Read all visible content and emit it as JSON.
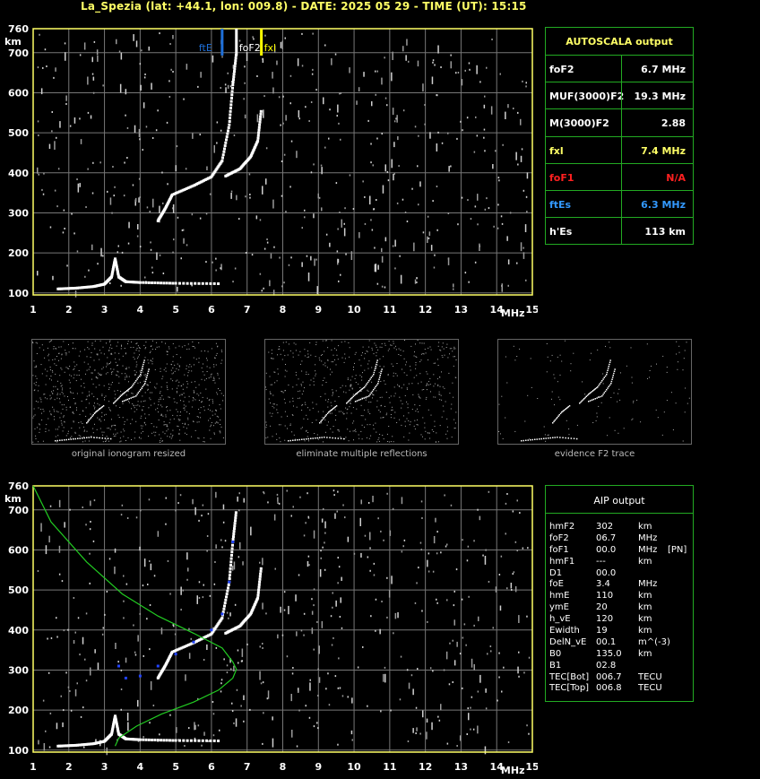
{
  "header": "La_Spezia (lat: +44.1, lon: 009.8) - DATE: 2025 05 29 - TIME (UT): 15:15",
  "colors": {
    "grid": "#777777",
    "axis": "#ffff66",
    "panel_border": "#22aa22",
    "trace": "#ffffff",
    "fxl": "#ffff00",
    "ftE": "#1e6fd9",
    "foF1": "#ff2020",
    "profile": "#22cc22",
    "aip_points": "#2244ff"
  },
  "axis": {
    "y_unit": "km",
    "x_unit": "MHz",
    "y_ticks": [
      "760",
      "700",
      "600",
      "500",
      "400",
      "300",
      "200",
      "100"
    ],
    "x_ticks": [
      "1",
      "2",
      "3",
      "4",
      "5",
      "6",
      "7",
      "8",
      "9",
      "10",
      "11",
      "12",
      "13",
      "14",
      "15"
    ]
  },
  "markers": {
    "ftE": "ftE",
    "foF2": "foF2",
    "fxl": "fxl"
  },
  "autoscala": {
    "title": "AUTOSCALA output",
    "rows": [
      {
        "key": "foF2",
        "value": "6.7 MHz",
        "color": "#ffffff"
      },
      {
        "key": "MUF(3000)F2",
        "value": "19.3 MHz",
        "color": "#ffffff"
      },
      {
        "key": "M(3000)F2",
        "value": "2.88",
        "color": "#ffffff"
      },
      {
        "key": "fxl",
        "value": "7.4 MHz",
        "color": "#ffff66"
      },
      {
        "key": "foF1",
        "value": "N/A",
        "color": "#ff2020"
      },
      {
        "key": "ftEs",
        "value": "6.3 MHz",
        "color": "#3399ff"
      },
      {
        "key": "h'Es",
        "value": "113     km",
        "color": "#ffffff"
      }
    ]
  },
  "captions": {
    "thumb1": "original ionogram resized",
    "thumb2": "eliminate multiple reflections",
    "thumb3": "evidence F2 trace"
  },
  "aip": {
    "title": "AIP output",
    "rows": [
      [
        "hmF2",
        "302",
        "km",
        ""
      ],
      [
        "foF2",
        "06.7",
        "MHz",
        ""
      ],
      [
        "foF1",
        "00.0",
        "MHz",
        "[PN]"
      ],
      [
        "hmF1",
        "---",
        "km",
        ""
      ],
      [
        "D1",
        "00.0",
        "",
        ""
      ],
      [
        "foE",
        "3.4",
        "MHz",
        ""
      ],
      [
        "hmE",
        "110",
        "km",
        ""
      ],
      [
        "ymE",
        "20",
        "km",
        ""
      ],
      [
        "h_vE",
        "120",
        "km",
        ""
      ],
      [
        "Ewidth",
        "19",
        "km",
        ""
      ],
      [
        "DelN_vE",
        "00.1",
        "m^(-3)",
        ""
      ],
      [
        "B0",
        "135.0",
        "km",
        ""
      ],
      [
        "B1",
        "02.8",
        "",
        ""
      ],
      [
        "TEC[Bot]",
        "006.7",
        "TECU",
        ""
      ],
      [
        "TEC[Top]",
        "006.8",
        "TECU",
        ""
      ]
    ]
  },
  "chart_data": [
    {
      "type": "scatter",
      "title": "",
      "xlabel": "MHz",
      "ylabel": "km",
      "xlim": [
        1,
        15
      ],
      "ylim": [
        95,
        760
      ],
      "grid": true,
      "series": [
        {
          "name": "",
          "values": [
            [
              1.7,
              110
            ],
            [
              2.2,
              112
            ],
            [
              2.7,
              116
            ],
            [
              3.0,
              122
            ],
            [
              3.2,
              140
            ],
            [
              3.3,
              185
            ],
            [
              3.4,
              140
            ],
            [
              3.6,
              128
            ],
            [
              4.0,
              126
            ],
            [
              5.0,
              124
            ],
            [
              6.3,
              123
            ]
          ]
        },
        {
          "name": "",
          "values": [
            [
              4.5,
              280
            ],
            [
              4.7,
              310
            ],
            [
              4.9,
              345
            ],
            [
              5.5,
              368
            ],
            [
              6.0,
              390
            ],
            [
              6.3,
              430
            ],
            [
              6.5,
              520
            ],
            [
              6.6,
              620
            ],
            [
              6.7,
              700
            ]
          ]
        },
        {
          "name": "",
          "values": [
            [
              6.4,
              392
            ],
            [
              6.8,
              410
            ],
            [
              7.1,
              440
            ],
            [
              7.3,
              480
            ],
            [
              7.4,
              560
            ]
          ]
        }
      ],
      "annotations": [
        {
          "label": "ftE",
          "x": 6.3
        },
        {
          "label": "foF2",
          "x": 6.7
        },
        {
          "label": "fxl",
          "x": 7.4
        }
      ]
    },
    {
      "type": "line",
      "title": "",
      "xlabel": "MHz",
      "ylabel": "km",
      "xlim": [
        1,
        15
      ],
      "ylim": [
        95,
        760
      ],
      "grid": true,
      "series": [
        {
          "name": "",
          "values": [
            [
              1.0,
              760
            ],
            [
              1.5,
              670
            ],
            [
              2.5,
              570
            ],
            [
              3.5,
              490
            ],
            [
              4.5,
              435
            ],
            [
              5.5,
              392
            ],
            [
              6.3,
              355
            ],
            [
              6.6,
              320
            ],
            [
              6.7,
              302
            ],
            [
              6.6,
              280
            ],
            [
              6.2,
              250
            ],
            [
              5.5,
              220
            ],
            [
              4.6,
              190
            ],
            [
              3.9,
              160
            ],
            [
              3.4,
              130
            ],
            [
              3.3,
              110
            ]
          ]
        },
        {
          "name": "",
          "values": [
            [
              3.4,
              310
            ],
            [
              3.6,
              280
            ],
            [
              4.0,
              285
            ],
            [
              4.5,
              310
            ],
            [
              5.0,
              340
            ],
            [
              5.5,
              370
            ],
            [
              6.0,
              400
            ],
            [
              6.3,
              440
            ],
            [
              6.5,
              520
            ],
            [
              6.6,
              620
            ]
          ]
        }
      ]
    }
  ]
}
